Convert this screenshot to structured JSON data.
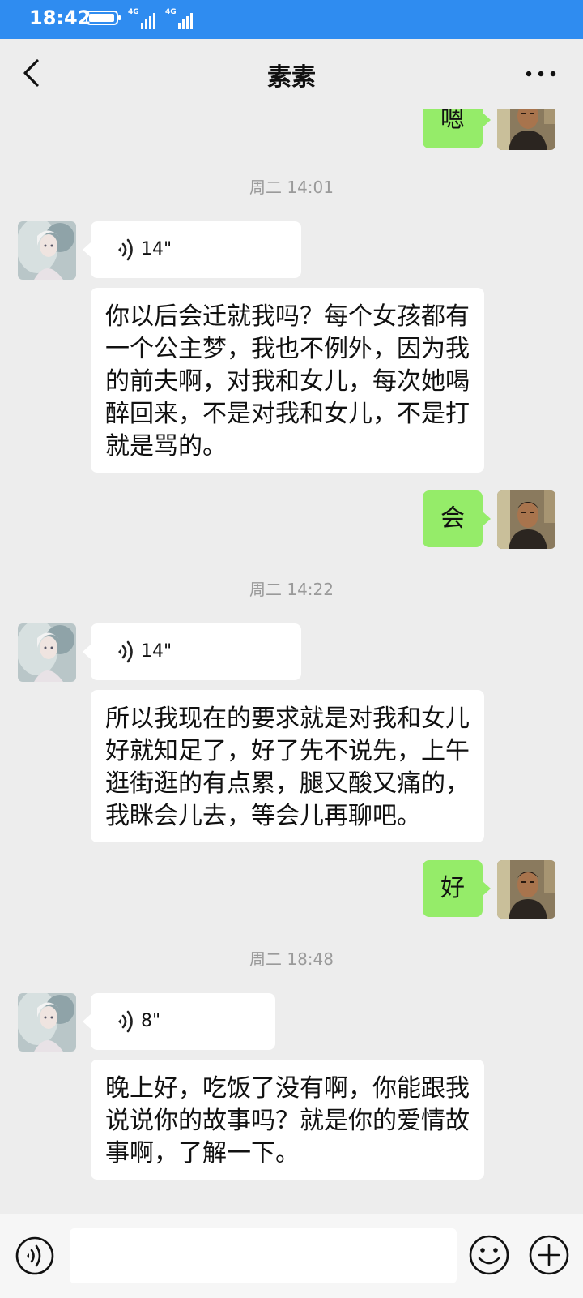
{
  "status_bar": {
    "time": "18:42",
    "net1": "4G",
    "net2": "4G"
  },
  "header": {
    "title": "素素"
  },
  "messages": [
    {
      "kind": "sent",
      "text": "嗯"
    },
    {
      "kind": "time",
      "text": "周二 14:01"
    },
    {
      "kind": "voice",
      "duration": "14\""
    },
    {
      "kind": "received",
      "text": "你以后会迁就我吗？每个女孩都有一个公主梦，我也不例外，因为我的前夫啊，对我和女儿，每次她喝醉回来，不是对我和女儿，不是打就是骂的。"
    },
    {
      "kind": "sent",
      "text": "会"
    },
    {
      "kind": "time",
      "text": "周二 14:22"
    },
    {
      "kind": "voice",
      "duration": "14\""
    },
    {
      "kind": "received",
      "text": "所以我现在的要求就是对我和女儿好就知足了，好了先不说先，上午逛街逛的有点累，腿又酸又痛的，我眯会儿去，等会儿再聊吧。"
    },
    {
      "kind": "sent",
      "text": "好"
    },
    {
      "kind": "time",
      "text": "周二 18:48"
    },
    {
      "kind": "voice",
      "duration": "8\""
    },
    {
      "kind": "received",
      "text": "晚上好，吃饭了没有啊，你能跟我说说你的故事吗？就是你的爱情故事啊，了解一下。"
    }
  ],
  "input": {
    "value": ""
  },
  "icons": [
    "back-icon",
    "more-icon",
    "voice-wave-icon",
    "voice-mode-icon",
    "emoji-icon",
    "plus-icon"
  ],
  "colors": {
    "status_bar": "#2f8cf0",
    "sent_bubble": "#95ec69",
    "received_bubble": "#ffffff",
    "background": "#ededed"
  }
}
